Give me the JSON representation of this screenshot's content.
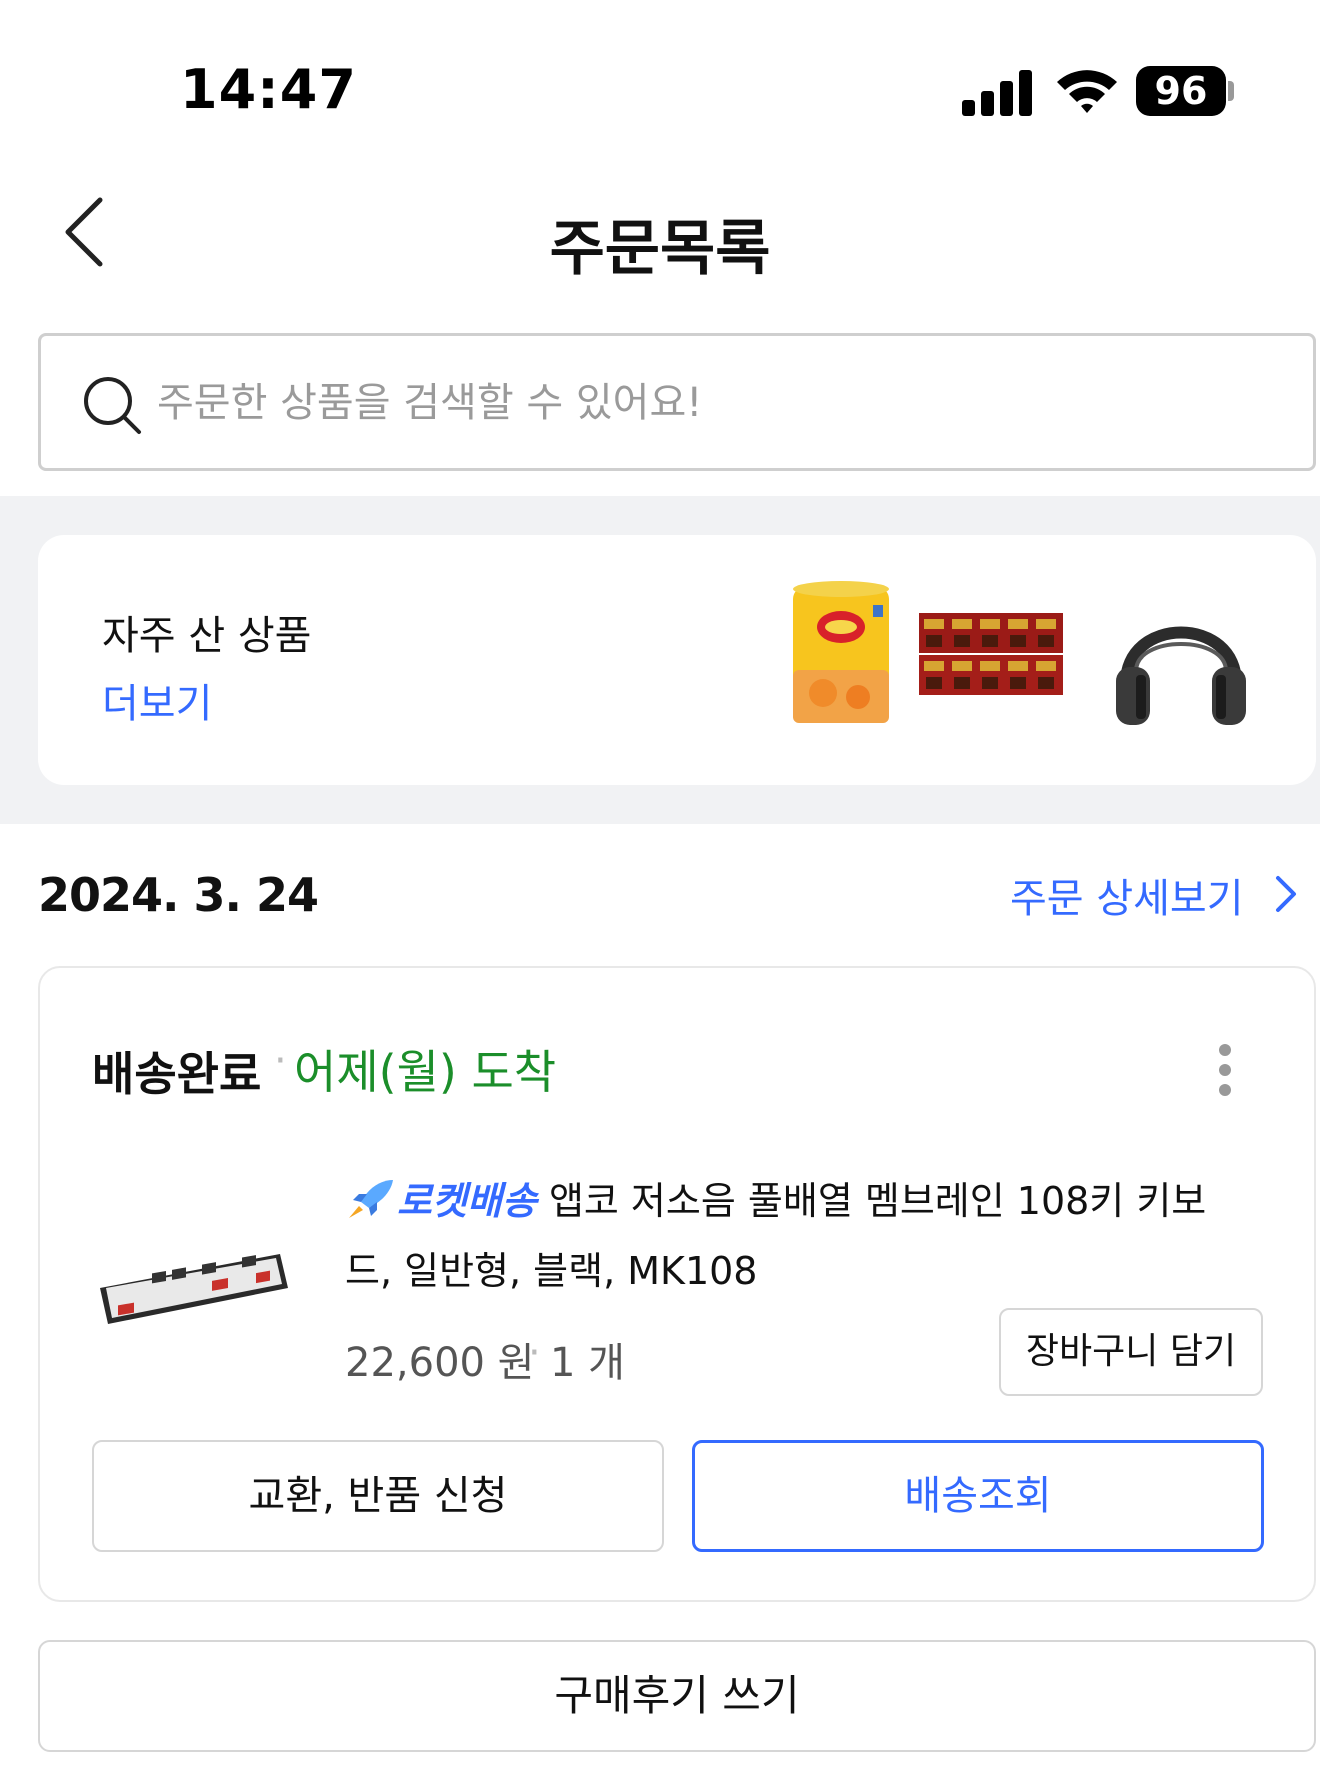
{
  "status_bar": {
    "time": "14:47",
    "battery": "96"
  },
  "header": {
    "title": "주문목록"
  },
  "search": {
    "placeholder": "주문한 상품을 검색할 수 있어요!"
  },
  "frequent": {
    "title": "자주 산 상품",
    "more_label": "더보기"
  },
  "order": {
    "date": "2024. 3. 24",
    "detail_link": "주문 상세보기",
    "status": "배송완료",
    "separator": "·",
    "arrival": "어제(월) 도착",
    "product": {
      "badge": "로켓배송",
      "name_line1": "앱코 저소음 풀배열 멤브레인 108키 키보",
      "name_line2": "드, 일반형, 블랙, MK108",
      "price": "22,600 원",
      "quantity": "1 개"
    },
    "cart_button": "장바구니 담기",
    "exchange_button": "교환, 반품 신청",
    "tracking_button": "배송조회",
    "review_button": "구매후기 쓰기"
  },
  "colors": {
    "accent_blue": "#346aff",
    "arrival_green": "#1b8e2a",
    "band_grey": "#f1f2f4"
  }
}
